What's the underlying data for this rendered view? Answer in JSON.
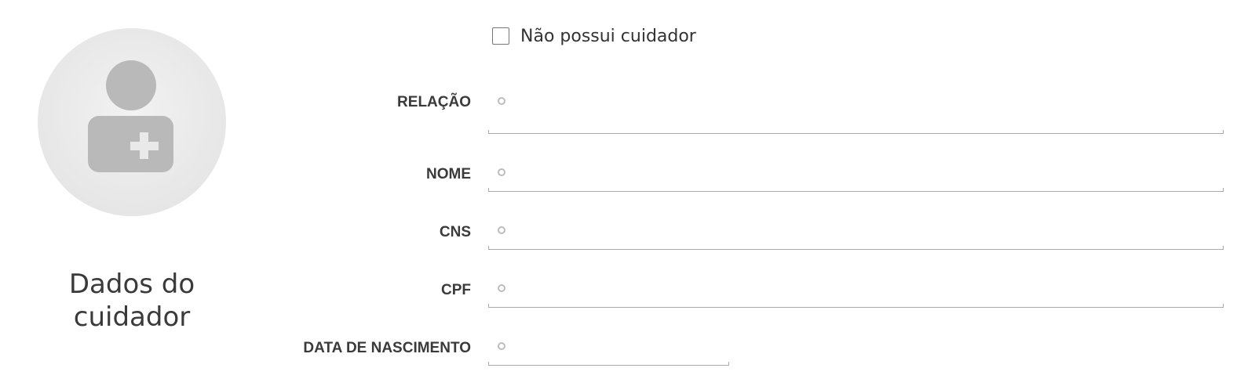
{
  "section": {
    "title_line1": "Dados do",
    "title_line2": "cuidador",
    "avatar_icon": "person-plus-icon"
  },
  "no_caregiver": {
    "label": "Não possui cuidador",
    "checked": false
  },
  "fields": {
    "relacao": {
      "label": "RELAÇÃO",
      "value": ""
    },
    "nome": {
      "label": "NOME",
      "value": ""
    },
    "cns": {
      "label": "CNS",
      "value": ""
    },
    "cpf": {
      "label": "CPF",
      "value": ""
    },
    "data_nascimento": {
      "label": "DATA DE NASCIMENTO",
      "value": ""
    }
  },
  "colors": {
    "avatar_bg": "#e8e8e8",
    "avatar_icon": "#b9b9b9",
    "underline": "#aaaaaa",
    "required_dot": "#bdbdbd"
  }
}
